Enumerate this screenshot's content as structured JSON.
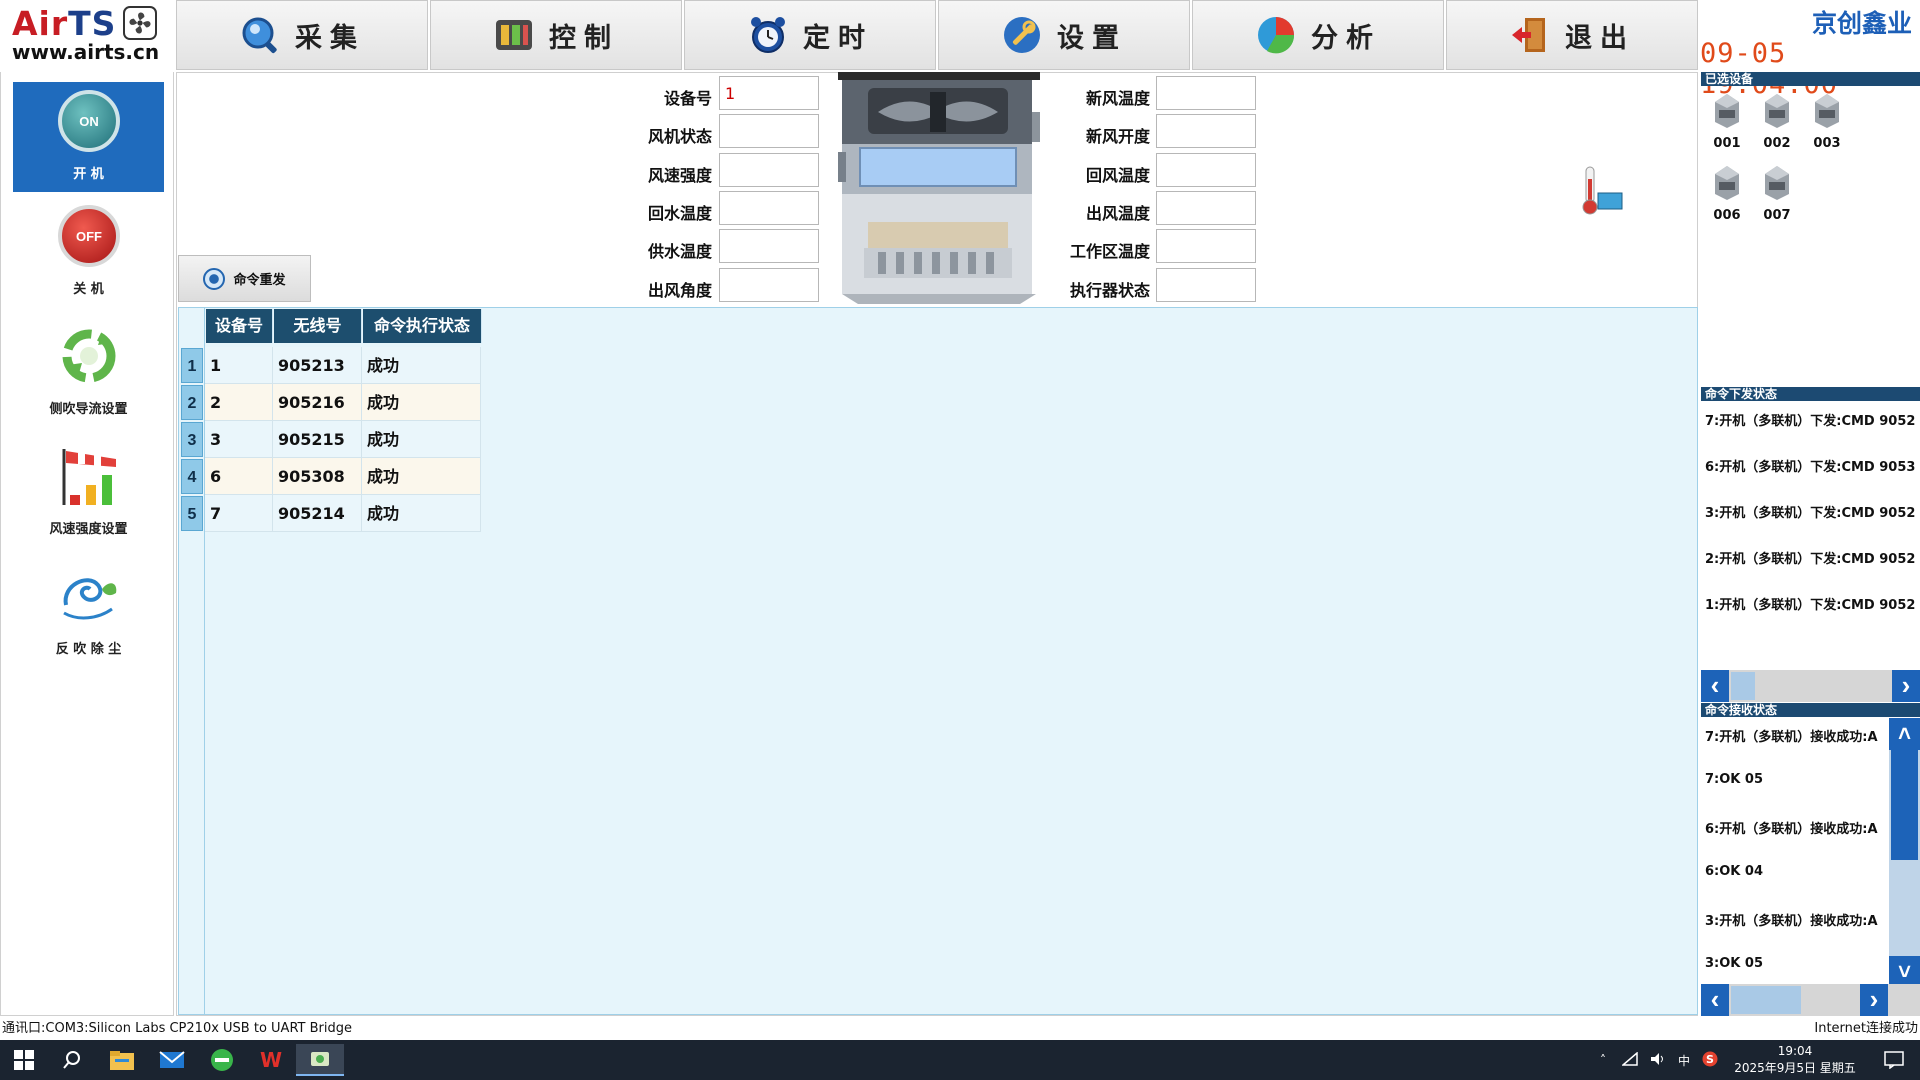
{
  "logo": {
    "brand_a": "Air",
    "brand_b": "TS",
    "url": "www.airts.cn"
  },
  "nav": [
    {
      "label": "采集",
      "icon": "magnifier-icon"
    },
    {
      "label": "控制",
      "icon": "control-panel-icon"
    },
    {
      "label": "定时",
      "icon": "alarm-clock-icon"
    },
    {
      "label": "设置",
      "icon": "wrench-icon"
    },
    {
      "label": "分析",
      "icon": "pie-chart-icon"
    },
    {
      "label": "退出",
      "icon": "exit-door-icon"
    }
  ],
  "brand": {
    "name": "京创鑫业",
    "clock": "09-05  19:04:00"
  },
  "sidebar": [
    {
      "label": "开 机",
      "icon": "power-on-icon",
      "badge": "ON",
      "active": true
    },
    {
      "label": "关 机",
      "icon": "power-off-icon",
      "badge": "OFF",
      "active": false
    },
    {
      "label": "侧吹导流设置",
      "icon": "recycle-arrows-icon",
      "active": false
    },
    {
      "label": "风速强度设置",
      "icon": "windsock-bars-icon",
      "active": false
    },
    {
      "label": "反 吹 除 尘",
      "icon": "swirl-leaf-icon",
      "active": false
    }
  ],
  "fields": {
    "left": [
      {
        "label": "设备号",
        "value": "1"
      },
      {
        "label": "风机状态",
        "value": ""
      },
      {
        "label": "风速强度",
        "value": ""
      },
      {
        "label": "回水温度",
        "value": ""
      },
      {
        "label": "供水温度",
        "value": ""
      },
      {
        "label": "出风角度",
        "value": ""
      }
    ],
    "right": [
      {
        "label": "新风温度",
        "value": ""
      },
      {
        "label": "新风开度",
        "value": ""
      },
      {
        "label": "回风温度",
        "value": ""
      },
      {
        "label": "出风温度",
        "value": ""
      },
      {
        "label": "工作区温度",
        "value": ""
      },
      {
        "label": "执行器状态",
        "value": ""
      }
    ]
  },
  "resend_button": "命令重发",
  "table": {
    "headers": [
      "设备号",
      "无线号",
      "命令执行状态"
    ],
    "rows": [
      {
        "n": "1",
        "device": "1",
        "wireless": "905213",
        "status": "成功"
      },
      {
        "n": "2",
        "device": "2",
        "wireless": "905216",
        "status": "成功"
      },
      {
        "n": "3",
        "device": "3",
        "wireless": "905215",
        "status": "成功"
      },
      {
        "n": "4",
        "device": "6",
        "wireless": "905308",
        "status": "成功"
      },
      {
        "n": "5",
        "device": "7",
        "wireless": "905214",
        "status": "成功"
      }
    ]
  },
  "right": {
    "selected_title": "已选设备",
    "devices": [
      "001",
      "002",
      "003",
      "006",
      "007"
    ],
    "send_title": "命令下发状态",
    "send_log": [
      "7:开机（多联机）下发:CMD 9052",
      "6:开机（多联机）下发:CMD 9053",
      "3:开机（多联机）下发:CMD 9052",
      "2:开机（多联机）下发:CMD 9052",
      "1:开机（多联机）下发:CMD 9052"
    ],
    "recv_title": "命令接收状态",
    "recv_log": [
      "7:开机（多联机）接收成功:A",
      "7:OK 05",
      "6:开机（多联机）接收成功:A",
      "6:OK 04",
      "3:开机（多联机）接收成功:A",
      "3:OK 05"
    ]
  },
  "statusbar": {
    "left": "通讯口:COM3:Silicon Labs CP210x USB to UART Bridge",
    "right": "Internet连接成功"
  },
  "taskbar": {
    "time": "19:04",
    "date": "2025年9月5日 星期五",
    "ime": "中",
    "apps": [
      "windows-start-icon",
      "search-icon",
      "file-explorer-icon",
      "mail-icon",
      "browser-icon",
      "wps-office-icon",
      "app-active-icon"
    ]
  }
}
